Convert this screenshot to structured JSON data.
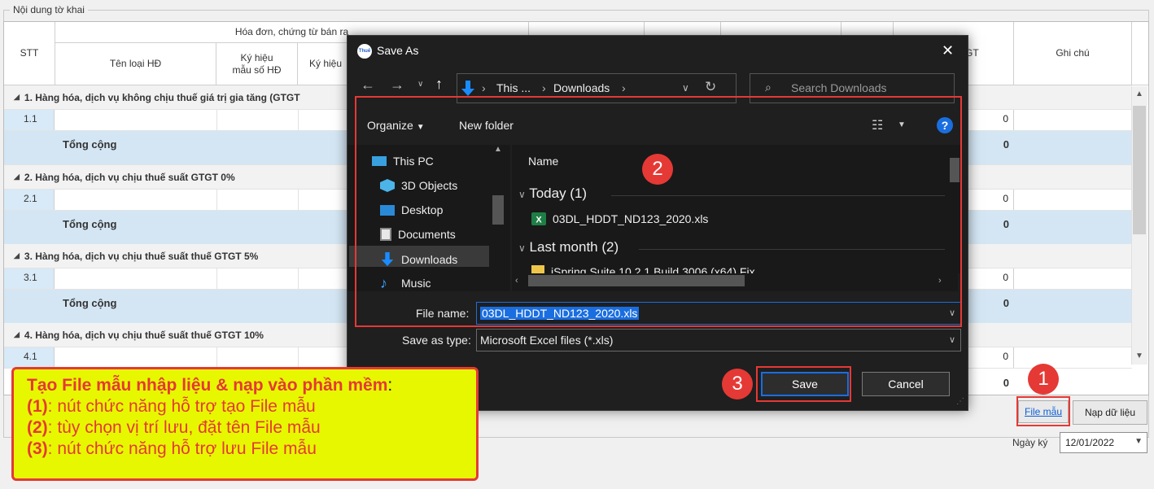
{
  "form": {
    "group_title": "Nội dung tờ khai",
    "headers": {
      "stt": "STT",
      "invoice_group": "Hóa đơn, chứng từ bán ra",
      "invoice_type": "Tên loại HĐ",
      "template_code_line1": "Ký hiệu",
      "template_code_line2": "mẫu số HĐ",
      "symbol_partial": "Ký hiệu",
      "tax_partial": "GT",
      "notes": "Ghi chú"
    },
    "sections": [
      {
        "title": "1. Hàng hóa, dịch vụ không chịu thuế giá trị gia tăng (GTGT",
        "row": "1.1",
        "row_value": "0",
        "total_label": "Tổng cộng",
        "total_value": "0"
      },
      {
        "title": "2. Hàng hóa, dịch vụ chịu thuế suất GTGT 0%",
        "row": "2.1",
        "row_value": "0",
        "total_label": "Tổng cộng",
        "total_value": "0"
      },
      {
        "title": "3. Hàng hóa, dịch vụ chịu thuế suất thuế GTGT 5%",
        "row": "3.1",
        "row_value": "0",
        "total_label": "Tổng cộng",
        "total_value": "0"
      },
      {
        "title": "4. Hàng hóa, dịch vụ chịu thuế suất thuế GTGT 10%",
        "row": "4.1",
        "row_value": "0",
        "total_label": "",
        "total_value": "0"
      }
    ],
    "buttons": {
      "template_file": "File mẫu",
      "import_data": "Nạp dữ liệu"
    },
    "sign_date_label": "Ngày ký",
    "sign_date_value": "12/01/2022"
  },
  "dialog": {
    "title": "Save As",
    "close_glyph": "✕",
    "breadcrumb": {
      "part1": "This ...",
      "sep": "›",
      "part2": "Downloads"
    },
    "search_placeholder": "Search Downloads",
    "toolbar": {
      "organize": "Organize",
      "new_folder": "New folder",
      "help": "?"
    },
    "nav_items": [
      {
        "label": "This PC",
        "icon": "computer-icon"
      },
      {
        "label": "3D Objects",
        "icon": "cube-icon"
      },
      {
        "label": "Desktop",
        "icon": "desktop-icon"
      },
      {
        "label": "Documents",
        "icon": "document-icon"
      },
      {
        "label": "Downloads",
        "icon": "download-icon"
      },
      {
        "label": "Music",
        "icon": "music-icon"
      }
    ],
    "column_name": "Name",
    "groups": [
      {
        "label": "Today (1)",
        "file": "03DL_HDDT_ND123_2020.xls",
        "icon": "excel-icon"
      },
      {
        "label": "Last month (2)",
        "file": "iSpring Suite 10.2.1 Build 3006 (x64) Fix",
        "icon": "folder-icon"
      }
    ],
    "file_name_label": "File name:",
    "file_name_value": "03DL_HDDT_ND123_2020.xls",
    "save_type_label": "Save as type:",
    "save_type_value": "Microsoft Excel files  (*.xls)",
    "save_button": "Save",
    "cancel_button": "Cancel",
    "app_icon_text": "Thuế"
  },
  "annotations": {
    "badge1": "1",
    "badge2": "2",
    "badge3": "3",
    "note_title": "Tạo File mẫu nhập liệu & nạp vào phần mềm",
    "note_colon": ":",
    "lines": [
      {
        "num": "(1)",
        "text": ": nút chức năng hỗ trợ tạo File mẫu"
      },
      {
        "num": "(2)",
        "text": ": tùy chọn vị trí lưu, đặt tên File mẫu"
      },
      {
        "num": "(3)",
        "text": ": nút chức năng hỗ trợ lưu File mẫu"
      }
    ],
    "accent_color": "#e53935",
    "note_background": "#e7f700"
  }
}
